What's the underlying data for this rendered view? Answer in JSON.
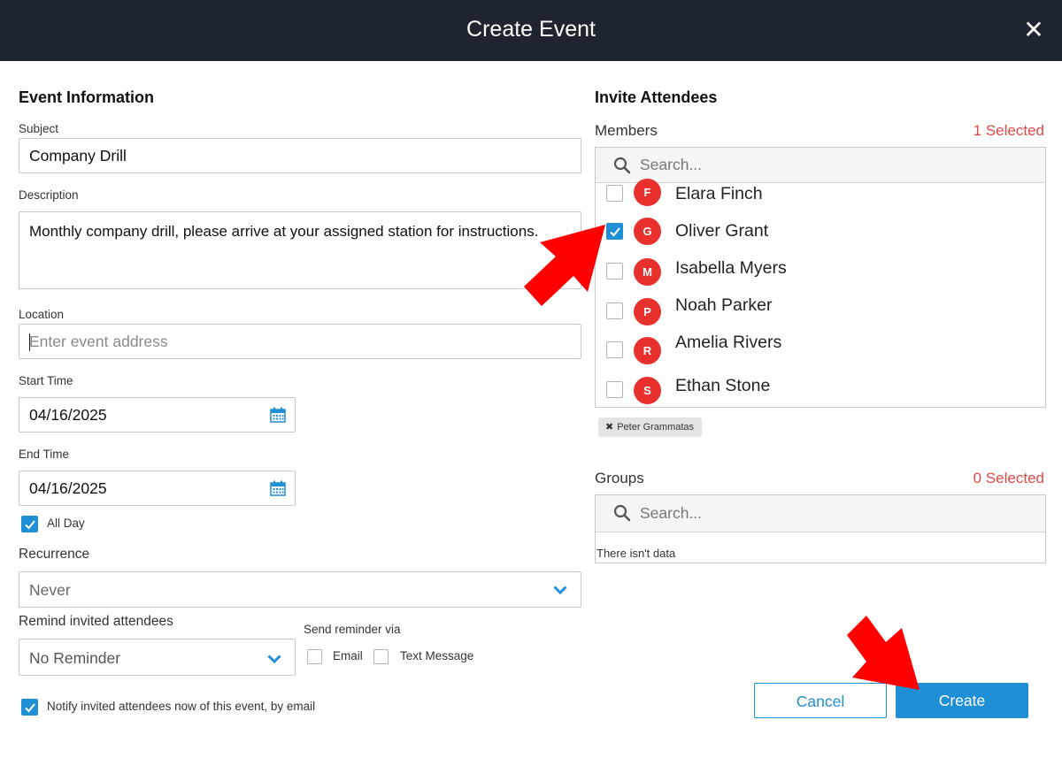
{
  "dialog": {
    "title": "Create Event",
    "close_icon": "close-icon"
  },
  "event_info": {
    "heading": "Event Information",
    "subject": {
      "label": "Subject",
      "value": "Company Drill"
    },
    "description": {
      "label": "Description",
      "value": "Monthly company drill, please arrive at your assigned station for instructions."
    },
    "location": {
      "label": "Location",
      "placeholder": "Enter event address",
      "value": ""
    },
    "start_time": {
      "label": "Start Time",
      "value": "04/16/2025"
    },
    "end_time": {
      "label": "End Time",
      "value": "04/16/2025"
    },
    "all_day": {
      "label": "All Day",
      "checked": true
    },
    "recurrence": {
      "label": "Recurrence",
      "selected": "Never"
    },
    "remind": {
      "label": "Remind invited attendees",
      "selected": "No Reminder"
    },
    "send_via": {
      "label": "Send reminder via",
      "email": "Email",
      "email_checked": false,
      "text": "Text Message",
      "text_checked": false
    },
    "notify": {
      "label": "Notify invited attendees now of this event, by email",
      "checked": true
    }
  },
  "invite": {
    "heading": "Invite Attendees",
    "members": {
      "label": "Members",
      "selected_count": "1 Selected",
      "search_placeholder": "Search...",
      "items": [
        {
          "initial": "F",
          "name": "Elara Finch",
          "checked": false
        },
        {
          "initial": "G",
          "name": "Oliver Grant",
          "checked": true
        },
        {
          "initial": "M",
          "name": "Isabella Myers",
          "checked": false
        },
        {
          "initial": "P",
          "name": "Noah Parker",
          "checked": false
        },
        {
          "initial": "R",
          "name": "Amelia Rivers",
          "checked": false
        },
        {
          "initial": "S",
          "name": "Ethan Stone",
          "checked": false
        }
      ],
      "chips": [
        {
          "label": "Peter Grammatas",
          "remove": "✖"
        }
      ]
    },
    "groups": {
      "label": "Groups",
      "selected_count": "0 Selected",
      "search_placeholder": "Search...",
      "empty_text": "There isn't data"
    }
  },
  "actions": {
    "cancel": "Cancel",
    "create": "Create"
  },
  "colors": {
    "header": "#1e2530",
    "accent": "#1f8fd6",
    "avatar": "#e8302c",
    "counter": "#e04848",
    "annotation_arrow": "#ff0000"
  }
}
